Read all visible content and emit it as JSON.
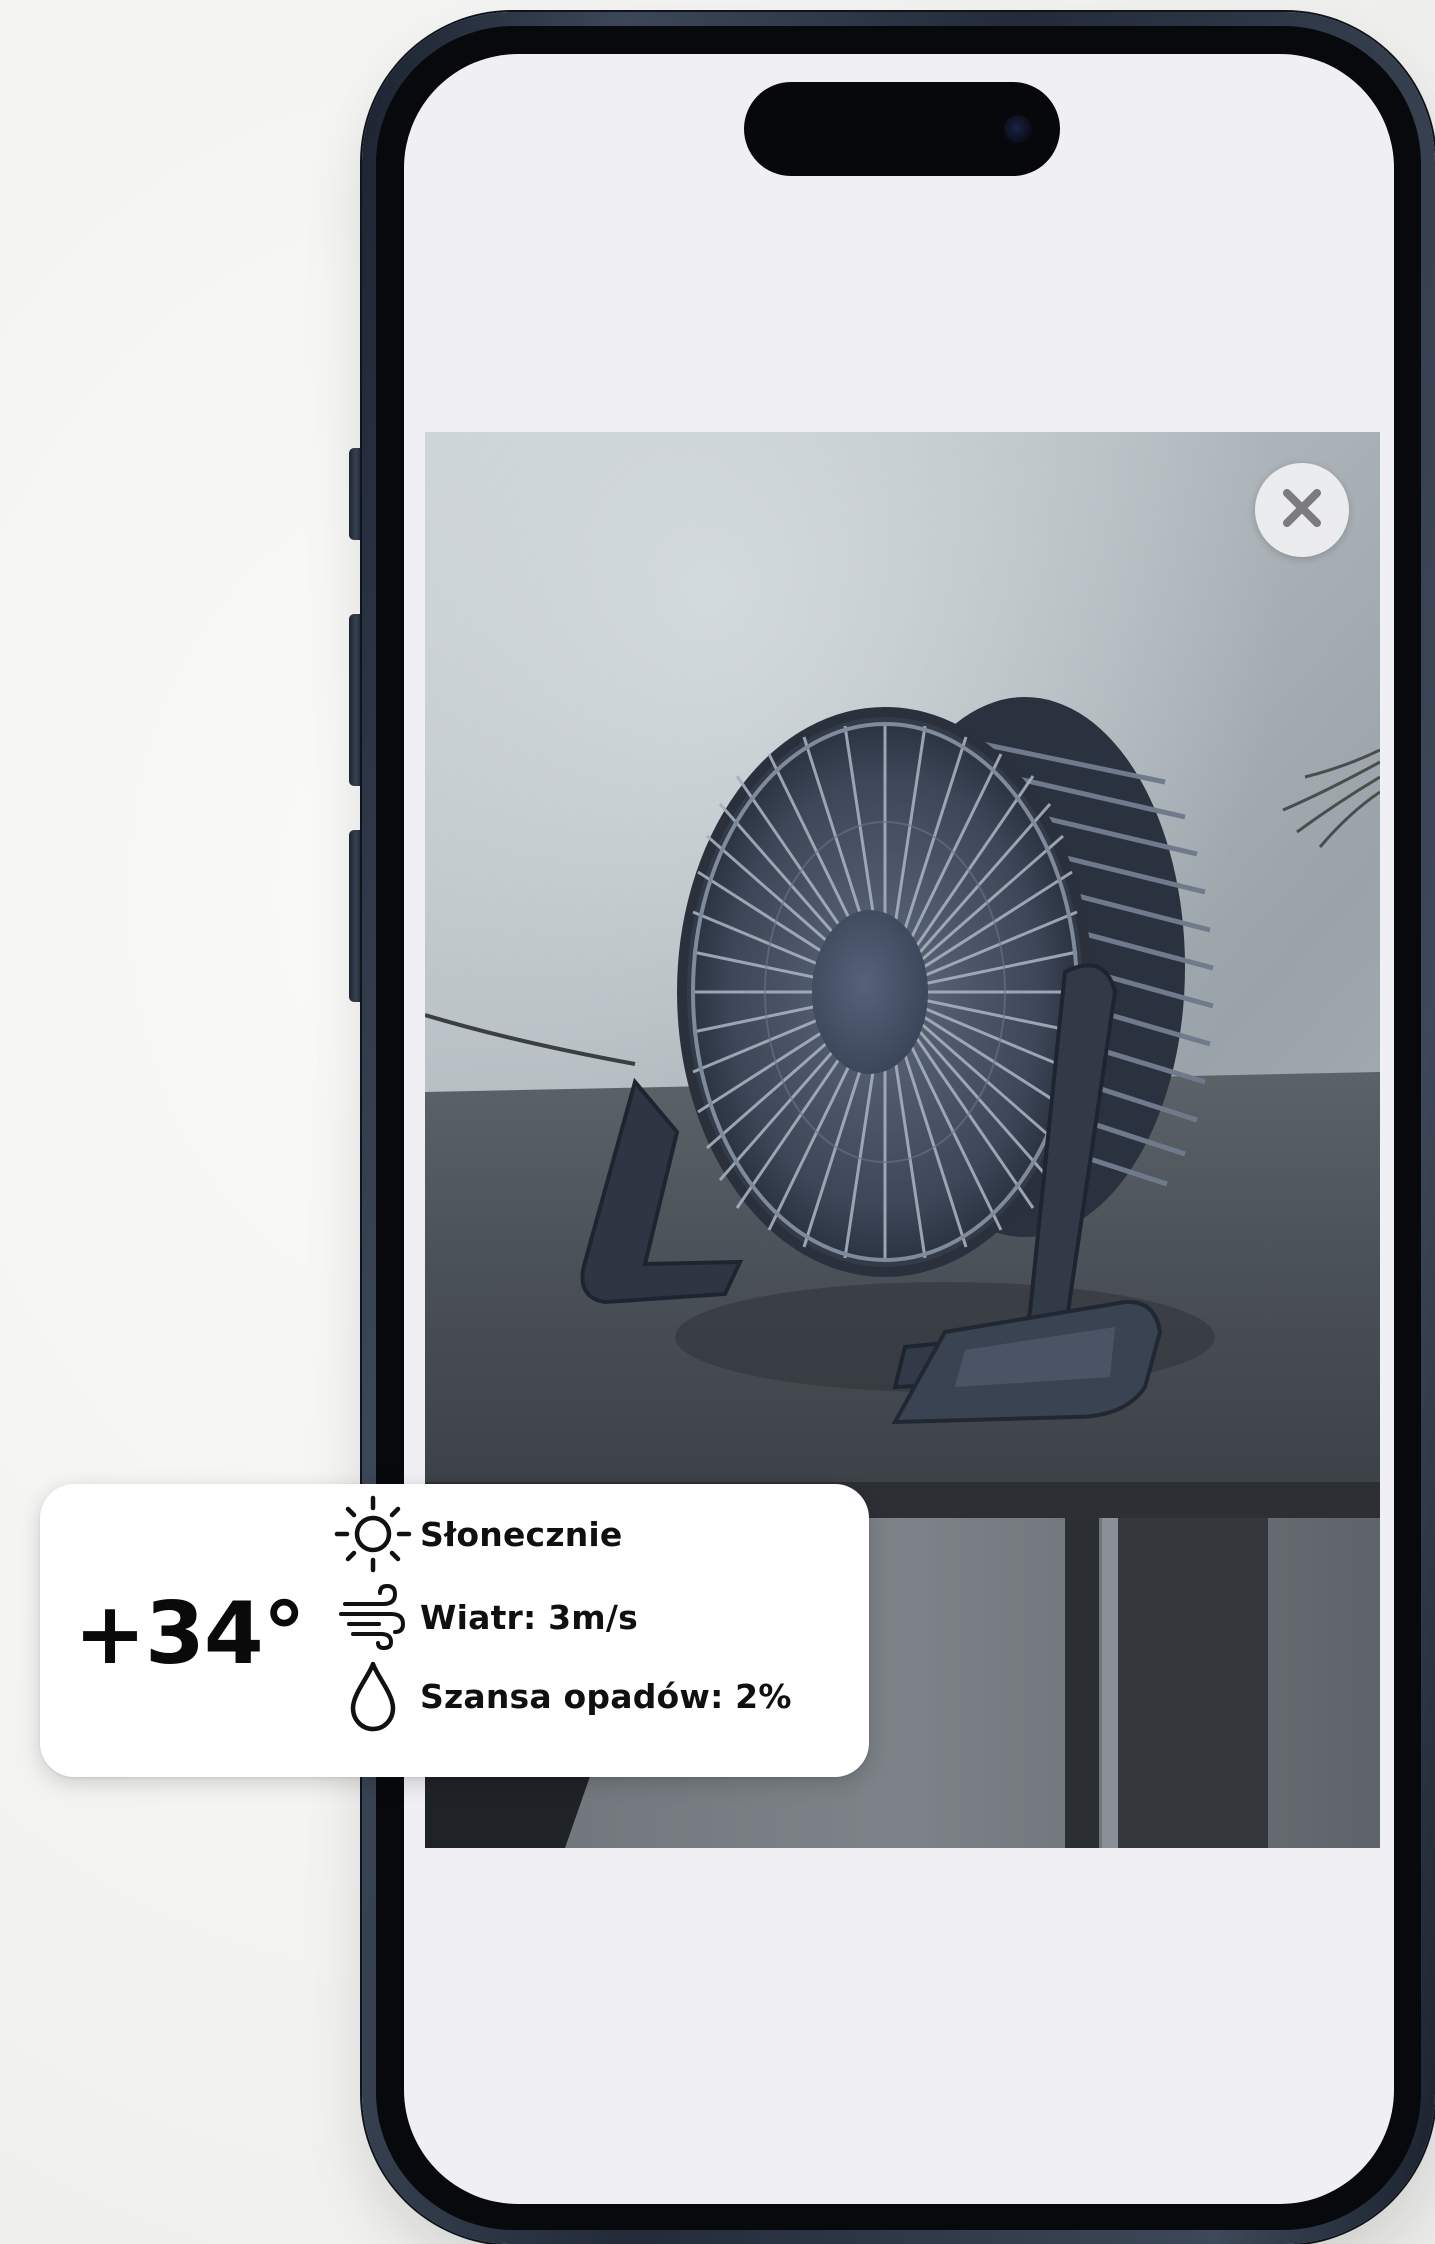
{
  "product_image": {
    "description_icon": "desk-fan-photo"
  },
  "close_button": {
    "icon": "close-icon"
  },
  "weather": {
    "temperature": "+34°",
    "condition": "Słonecznie",
    "condition_icon": "sun-icon",
    "wind": "Wiatr: 3m/s",
    "wind_icon": "wind-icon",
    "precipitation": "Szansa opadów: 2%",
    "precipitation_icon": "droplet-icon"
  },
  "colors": {
    "phone_frame": "#2c3543",
    "screen_background": "#f0eff3",
    "card_background": "#ffffff",
    "text": "#0a0a0a"
  }
}
